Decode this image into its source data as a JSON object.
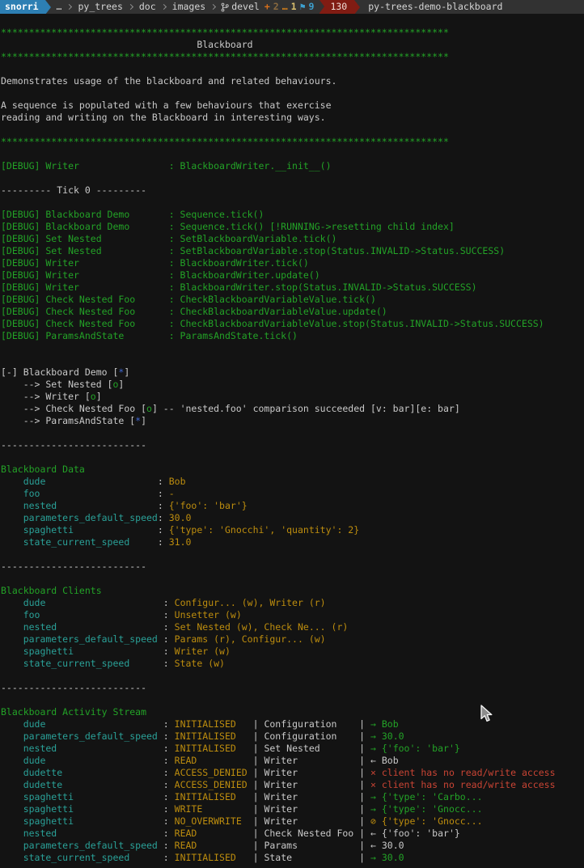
{
  "palette": {
    "terminal_bg": "#131313",
    "titlebar_bg": "#323232",
    "host_bg": "#2d7fb3",
    "exit_bg": "#801c13",
    "fg": "#c9c9c9",
    "green": "#23a327",
    "teal": "#2aa198",
    "orange": "#bd8d0e",
    "red": "#c94434",
    "blue": "#3f66d0"
  },
  "titlebar": {
    "host": "snorri",
    "path": [
      "…",
      "py_trees",
      "doc",
      "images"
    ],
    "git": {
      "branch": "devel",
      "status_tokens": [
        {
          "text": "+",
          "color": "#d9701a"
        },
        {
          "text": "2",
          "color": "#8a6a3f"
        },
        {
          "text": "…",
          "color": "#d9821a"
        },
        {
          "text": "1",
          "color": "#d9bf6e"
        },
        {
          "text": "⚑",
          "color": "#3da0cf"
        },
        {
          "text": "9",
          "color": "#3da0cf"
        }
      ]
    },
    "exit_code": "130",
    "window_title": "py-trees-demo-blackboard"
  },
  "terminal": {
    "lines": [
      [
        [
          "g",
          "********************************************************************************"
        ]
      ],
      [
        [
          "w",
          "                                   Blackboard"
        ]
      ],
      [
        [
          "g",
          "********************************************************************************"
        ]
      ],
      [],
      [
        [
          "w",
          "Demonstrates usage of the blackboard and related behaviours."
        ]
      ],
      [],
      [
        [
          "w",
          "A sequence is populated with a few behaviours that exercise"
        ]
      ],
      [
        [
          "w",
          "reading and writing on the Blackboard in interesting ways."
        ]
      ],
      [],
      [
        [
          "g",
          "********************************************************************************"
        ]
      ],
      [],
      [
        [
          "g",
          "[DEBUG] Writer                : BlackboardWriter.__init__()"
        ]
      ],
      [],
      [
        [
          "w",
          "--------- Tick 0 ---------"
        ]
      ],
      [],
      [
        [
          "g",
          "[DEBUG] Blackboard Demo       : Sequence.tick()"
        ]
      ],
      [
        [
          "g",
          "[DEBUG] Blackboard Demo       : Sequence.tick() [!RUNNING->resetting child index]"
        ]
      ],
      [
        [
          "g",
          "[DEBUG] Set Nested            : SetBlackboardVariable.tick()"
        ]
      ],
      [
        [
          "g",
          "[DEBUG] Set Nested            : SetBlackboardVariable.stop(Status.INVALID->Status.SUCCESS)"
        ]
      ],
      [
        [
          "g",
          "[DEBUG] Writer                : BlackboardWriter.tick()"
        ]
      ],
      [
        [
          "g",
          "[DEBUG] Writer                : BlackboardWriter.update()"
        ]
      ],
      [
        [
          "g",
          "[DEBUG] Writer                : BlackboardWriter.stop(Status.INVALID->Status.SUCCESS)"
        ]
      ],
      [
        [
          "g",
          "[DEBUG] Check Nested Foo      : CheckBlackboardVariableValue.tick()"
        ]
      ],
      [
        [
          "g",
          "[DEBUG] Check Nested Foo      : CheckBlackboardVariableValue.update()"
        ]
      ],
      [
        [
          "g",
          "[DEBUG] Check Nested Foo      : CheckBlackboardVariableValue.stop(Status.INVALID->Status.SUCCESS)"
        ]
      ],
      [
        [
          "g",
          "[DEBUG] ParamsAndState        : ParamsAndState.tick()"
        ]
      ],
      [],
      [],
      [
        [
          "w",
          "[-] Blackboard Demo ["
        ],
        [
          "b",
          "*"
        ],
        [
          "w",
          "]"
        ]
      ],
      [
        [
          "w",
          "    --> Set Nested ["
        ],
        [
          "g",
          "o"
        ],
        [
          "w",
          "]"
        ]
      ],
      [
        [
          "w",
          "    --> Writer ["
        ],
        [
          "g",
          "o"
        ],
        [
          "w",
          "]"
        ]
      ],
      [
        [
          "w",
          "    --> Check Nested Foo ["
        ],
        [
          "g",
          "o"
        ],
        [
          "w",
          "] -- 'nested.foo' comparison succeeded [v: bar][e: bar]"
        ]
      ],
      [
        [
          "w",
          "    --> ParamsAndState ["
        ],
        [
          "b",
          "*"
        ],
        [
          "w",
          "]"
        ]
      ],
      [],
      [
        [
          "w",
          "--------------------------"
        ]
      ],
      [],
      [
        [
          "g",
          "Blackboard Data"
        ]
      ],
      [
        [
          "t",
          "    dude                    "
        ],
        [
          "w",
          ": "
        ],
        [
          "o",
          "Bob"
        ]
      ],
      [
        [
          "t",
          "    foo                     "
        ],
        [
          "w",
          ": "
        ],
        [
          "o",
          "-"
        ]
      ],
      [
        [
          "t",
          "    nested                  "
        ],
        [
          "w",
          ": "
        ],
        [
          "o",
          "{'foo': 'bar'}"
        ]
      ],
      [
        [
          "t",
          "    parameters_default_speed"
        ],
        [
          "w",
          ": "
        ],
        [
          "o",
          "30.0"
        ]
      ],
      [
        [
          "t",
          "    spaghetti               "
        ],
        [
          "w",
          ": "
        ],
        [
          "o",
          "{'type': 'Gnocchi', 'quantity': 2}"
        ]
      ],
      [
        [
          "t",
          "    state_current_speed     "
        ],
        [
          "w",
          ": "
        ],
        [
          "o",
          "31.0"
        ]
      ],
      [],
      [
        [
          "w",
          "--------------------------"
        ]
      ],
      [],
      [
        [
          "g",
          "Blackboard Clients"
        ]
      ],
      [
        [
          "t",
          "    dude                     "
        ],
        [
          "w",
          ": "
        ],
        [
          "o",
          "Configur... (w), Writer (r)"
        ]
      ],
      [
        [
          "t",
          "    foo                      "
        ],
        [
          "w",
          ": "
        ],
        [
          "o",
          "Unsetter (w)"
        ]
      ],
      [
        [
          "t",
          "    nested                   "
        ],
        [
          "w",
          ": "
        ],
        [
          "o",
          "Set Nested (w), Check Ne... (r)"
        ]
      ],
      [
        [
          "t",
          "    parameters_default_speed "
        ],
        [
          "w",
          ": "
        ],
        [
          "o",
          "Params (r), Configur... (w)"
        ]
      ],
      [
        [
          "t",
          "    spaghetti                "
        ],
        [
          "w",
          ": "
        ],
        [
          "o",
          "Writer (w)"
        ]
      ],
      [
        [
          "t",
          "    state_current_speed      "
        ],
        [
          "w",
          ": "
        ],
        [
          "o",
          "State (w)"
        ]
      ],
      [],
      [
        [
          "w",
          "--------------------------"
        ]
      ],
      [],
      [
        [
          "g",
          "Blackboard Activity Stream"
        ]
      ],
      [
        [
          "t",
          "    dude                     "
        ],
        [
          "w",
          ": "
        ],
        [
          "o",
          "INITIALISED  "
        ],
        [
          "w",
          " | "
        ],
        [
          "w",
          "Configuration   "
        ],
        [
          "w",
          " | "
        ],
        [
          "g",
          "→ Bob"
        ]
      ],
      [
        [
          "t",
          "    parameters_default_speed "
        ],
        [
          "w",
          ": "
        ],
        [
          "o",
          "INITIALISED  "
        ],
        [
          "w",
          " | "
        ],
        [
          "w",
          "Configuration   "
        ],
        [
          "w",
          " | "
        ],
        [
          "g",
          "→ 30.0"
        ]
      ],
      [
        [
          "t",
          "    nested                   "
        ],
        [
          "w",
          ": "
        ],
        [
          "o",
          "INITIALISED  "
        ],
        [
          "w",
          " | "
        ],
        [
          "w",
          "Set Nested      "
        ],
        [
          "w",
          " | "
        ],
        [
          "g",
          "→ {'foo': 'bar'}"
        ]
      ],
      [
        [
          "t",
          "    dude                     "
        ],
        [
          "w",
          ": "
        ],
        [
          "o",
          "READ         "
        ],
        [
          "w",
          " | "
        ],
        [
          "w",
          "Writer          "
        ],
        [
          "w",
          " | "
        ],
        [
          "w",
          "← Bob"
        ]
      ],
      [
        [
          "t",
          "    dudette                  "
        ],
        [
          "w",
          ": "
        ],
        [
          "o",
          "ACCESS_DENIED"
        ],
        [
          "w",
          " | "
        ],
        [
          "w",
          "Writer          "
        ],
        [
          "w",
          " | "
        ],
        [
          "r",
          "× client has no read/write access"
        ]
      ],
      [
        [
          "t",
          "    dudette                  "
        ],
        [
          "w",
          ": "
        ],
        [
          "o",
          "ACCESS_DENIED"
        ],
        [
          "w",
          " | "
        ],
        [
          "w",
          "Writer          "
        ],
        [
          "w",
          " | "
        ],
        [
          "r",
          "× client has no read/write access"
        ]
      ],
      [
        [
          "t",
          "    spaghetti                "
        ],
        [
          "w",
          ": "
        ],
        [
          "o",
          "INITIALISED  "
        ],
        [
          "w",
          " | "
        ],
        [
          "w",
          "Writer          "
        ],
        [
          "w",
          " | "
        ],
        [
          "g",
          "→ {'type': 'Carbo..."
        ]
      ],
      [
        [
          "t",
          "    spaghetti                "
        ],
        [
          "w",
          ": "
        ],
        [
          "o",
          "WRITE        "
        ],
        [
          "w",
          " | "
        ],
        [
          "w",
          "Writer          "
        ],
        [
          "w",
          " | "
        ],
        [
          "g",
          "→ {'type': 'Gnocc..."
        ]
      ],
      [
        [
          "t",
          "    spaghetti                "
        ],
        [
          "w",
          ": "
        ],
        [
          "o",
          "NO_OVERWRITE "
        ],
        [
          "w",
          " | "
        ],
        [
          "w",
          "Writer          "
        ],
        [
          "w",
          " | "
        ],
        [
          "o",
          "⊘ {'type': 'Gnocc..."
        ]
      ],
      [
        [
          "t",
          "    nested                   "
        ],
        [
          "w",
          ": "
        ],
        [
          "o",
          "READ         "
        ],
        [
          "w",
          " | "
        ],
        [
          "w",
          "Check Nested Foo"
        ],
        [
          "w",
          " | "
        ],
        [
          "w",
          "← {'foo': 'bar'}"
        ]
      ],
      [
        [
          "t",
          "    parameters_default_speed "
        ],
        [
          "w",
          ": "
        ],
        [
          "o",
          "READ         "
        ],
        [
          "w",
          " | "
        ],
        [
          "w",
          "Params          "
        ],
        [
          "w",
          " | "
        ],
        [
          "w",
          "← 30.0"
        ]
      ],
      [
        [
          "t",
          "    state_current_speed      "
        ],
        [
          "w",
          ": "
        ],
        [
          "o",
          "INITIALISED  "
        ],
        [
          "w",
          " | "
        ],
        [
          "w",
          "State           "
        ],
        [
          "w",
          " | "
        ],
        [
          "g",
          "→ 30.0"
        ]
      ]
    ]
  }
}
